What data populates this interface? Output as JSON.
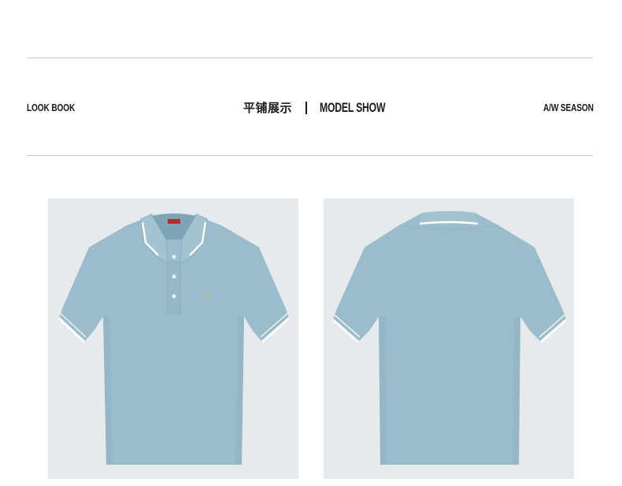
{
  "header": {
    "left_label": "LOOK BOOK",
    "title_cn": "平铺展示",
    "title_en": "MODEL SHOW",
    "right_label": "A/W SEASON"
  },
  "images": [
    {
      "view": "front",
      "description_icon": "polo-shirt-front-icon"
    },
    {
      "view": "back",
      "description_icon": "polo-shirt-back-icon"
    }
  ],
  "colors": {
    "shirt": "#9bbccb",
    "shirt_shade": "#8aafc0",
    "tipping": "#ffffff",
    "panel_bg": "#e6eaed",
    "label_red": "#b03030",
    "rule": "#c8c8c8"
  }
}
